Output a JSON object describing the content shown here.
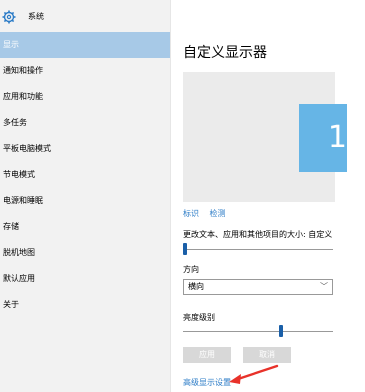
{
  "sidebar": {
    "header_title": "系统",
    "items": [
      {
        "label": "显示",
        "active": true
      },
      {
        "label": "通知和操作",
        "active": false
      },
      {
        "label": "应用和功能",
        "active": false
      },
      {
        "label": "多任务",
        "active": false
      },
      {
        "label": "平板电脑模式",
        "active": false
      },
      {
        "label": "节电模式",
        "active": false
      },
      {
        "label": "电源和睡眠",
        "active": false
      },
      {
        "label": "存储",
        "active": false
      },
      {
        "label": "脱机地图",
        "active": false
      },
      {
        "label": "默认应用",
        "active": false
      },
      {
        "label": "关于",
        "active": false
      }
    ]
  },
  "main": {
    "title": "自定义显示器",
    "monitor_number": "1",
    "links": {
      "identify": "标识",
      "detect": "检测"
    },
    "scale_label": "更改文本、应用和其他项目的大小: 自定义",
    "scale_level": 0.0,
    "orientation_label": "方向",
    "orientation_value": "横向",
    "brightness_label": "亮度级别",
    "brightness_level": 0.66,
    "apply_button": "应用",
    "cancel_button": "取消",
    "advanced_link": "高级显示设置"
  },
  "colors": {
    "accent": "#2c7cc7",
    "selected_nav": "#a7c9e7",
    "monitor": "#66b5e6",
    "arrow": "#e8322a"
  }
}
